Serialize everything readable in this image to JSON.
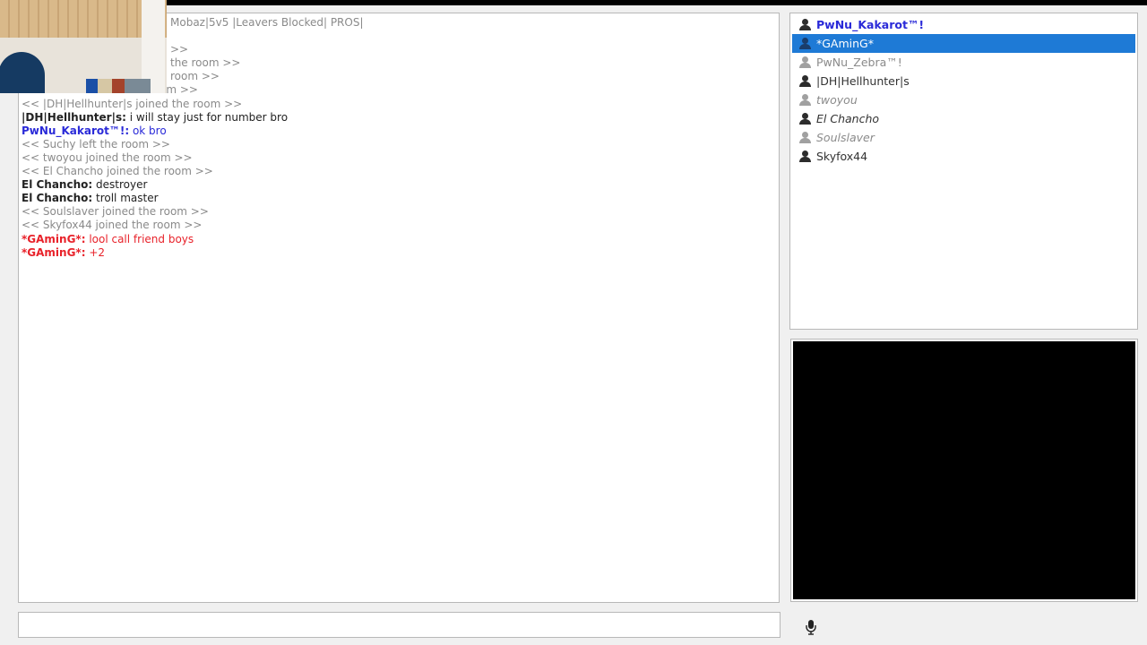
{
  "room": {
    "title_partial": "Mobaz|5v5 |Leavers Blocked| PROS|"
  },
  "chat": {
    "lines": [
      {
        "type": "sys",
        "text": "Mobaz|5v5 |Leavers Blocked| PROS|"
      },
      {
        "type": "sys",
        "text": ""
      },
      {
        "type": "sys",
        "text": ">>"
      },
      {
        "type": "sys",
        "text": "the room >>"
      },
      {
        "type": "sys",
        "text": "room >>"
      },
      {
        "type": "sys",
        "text": "om >>"
      },
      {
        "type": "sys",
        "text": "<< |DH|Hellhunter|s joined the room >>"
      },
      {
        "type": "black",
        "nick": "|DH|Hellhunter|s:",
        "text": " i will stay just for number bro"
      },
      {
        "type": "blue",
        "nick": "PwNu_Kakarot™!:",
        "text": " ok bro"
      },
      {
        "type": "sys",
        "text": "<< Suchy left the room >>"
      },
      {
        "type": "sys",
        "text": "<< twoyou joined the room >>"
      },
      {
        "type": "sys",
        "text": "<< El Chancho joined the room >>"
      },
      {
        "type": "black",
        "nick": "El Chancho:",
        "text": " destroyer"
      },
      {
        "type": "black",
        "nick": "El Chancho:",
        "text": " troll master"
      },
      {
        "type": "sys",
        "text": "<< Soulslaver joined the room >>"
      },
      {
        "type": "sys",
        "text": "<< Skyfox44 joined the room >>"
      },
      {
        "type": "red",
        "nick": "*GAminG*:",
        "text": " lool call friend boys"
      },
      {
        "type": "red",
        "nick": "*GAminG*:",
        "text": " +2"
      }
    ]
  },
  "users": [
    {
      "name": "PwNu_Kakarot™!",
      "style": "blue-bold",
      "icon": "user-icon",
      "icon_tone": "dark",
      "selected": false
    },
    {
      "name": "*GAminG*",
      "style": "selected",
      "icon": "user-icon",
      "icon_tone": "dark",
      "selected": true
    },
    {
      "name": "PwNu_Zebra™!",
      "style": "grey",
      "icon": "user-icon",
      "icon_tone": "grey",
      "selected": false
    },
    {
      "name": "|DH|Hellhunter|s",
      "style": "dark",
      "icon": "user-icon",
      "icon_tone": "dark",
      "selected": false
    },
    {
      "name": "twoyou",
      "style": "grey-italic",
      "icon": "user-icon",
      "icon_tone": "grey",
      "selected": false
    },
    {
      "name": "El Chancho",
      "style": "dark-italic",
      "icon": "user-icon",
      "icon_tone": "dark",
      "selected": false
    },
    {
      "name": "Soulslaver",
      "style": "grey-italic",
      "icon": "user-icon",
      "icon_tone": "grey",
      "selected": false
    },
    {
      "name": "Skyfox44",
      "style": "dark",
      "icon": "user-icon",
      "icon_tone": "dark",
      "selected": false
    }
  ],
  "input": {
    "value": "",
    "placeholder": ""
  },
  "mic": {
    "icon": "microphone-icon"
  },
  "colors": {
    "selection": "#1e7ad6",
    "nick_blue": "#2a2ad8",
    "nick_red": "#e8222a",
    "system_grey": "#8a8a8a"
  }
}
